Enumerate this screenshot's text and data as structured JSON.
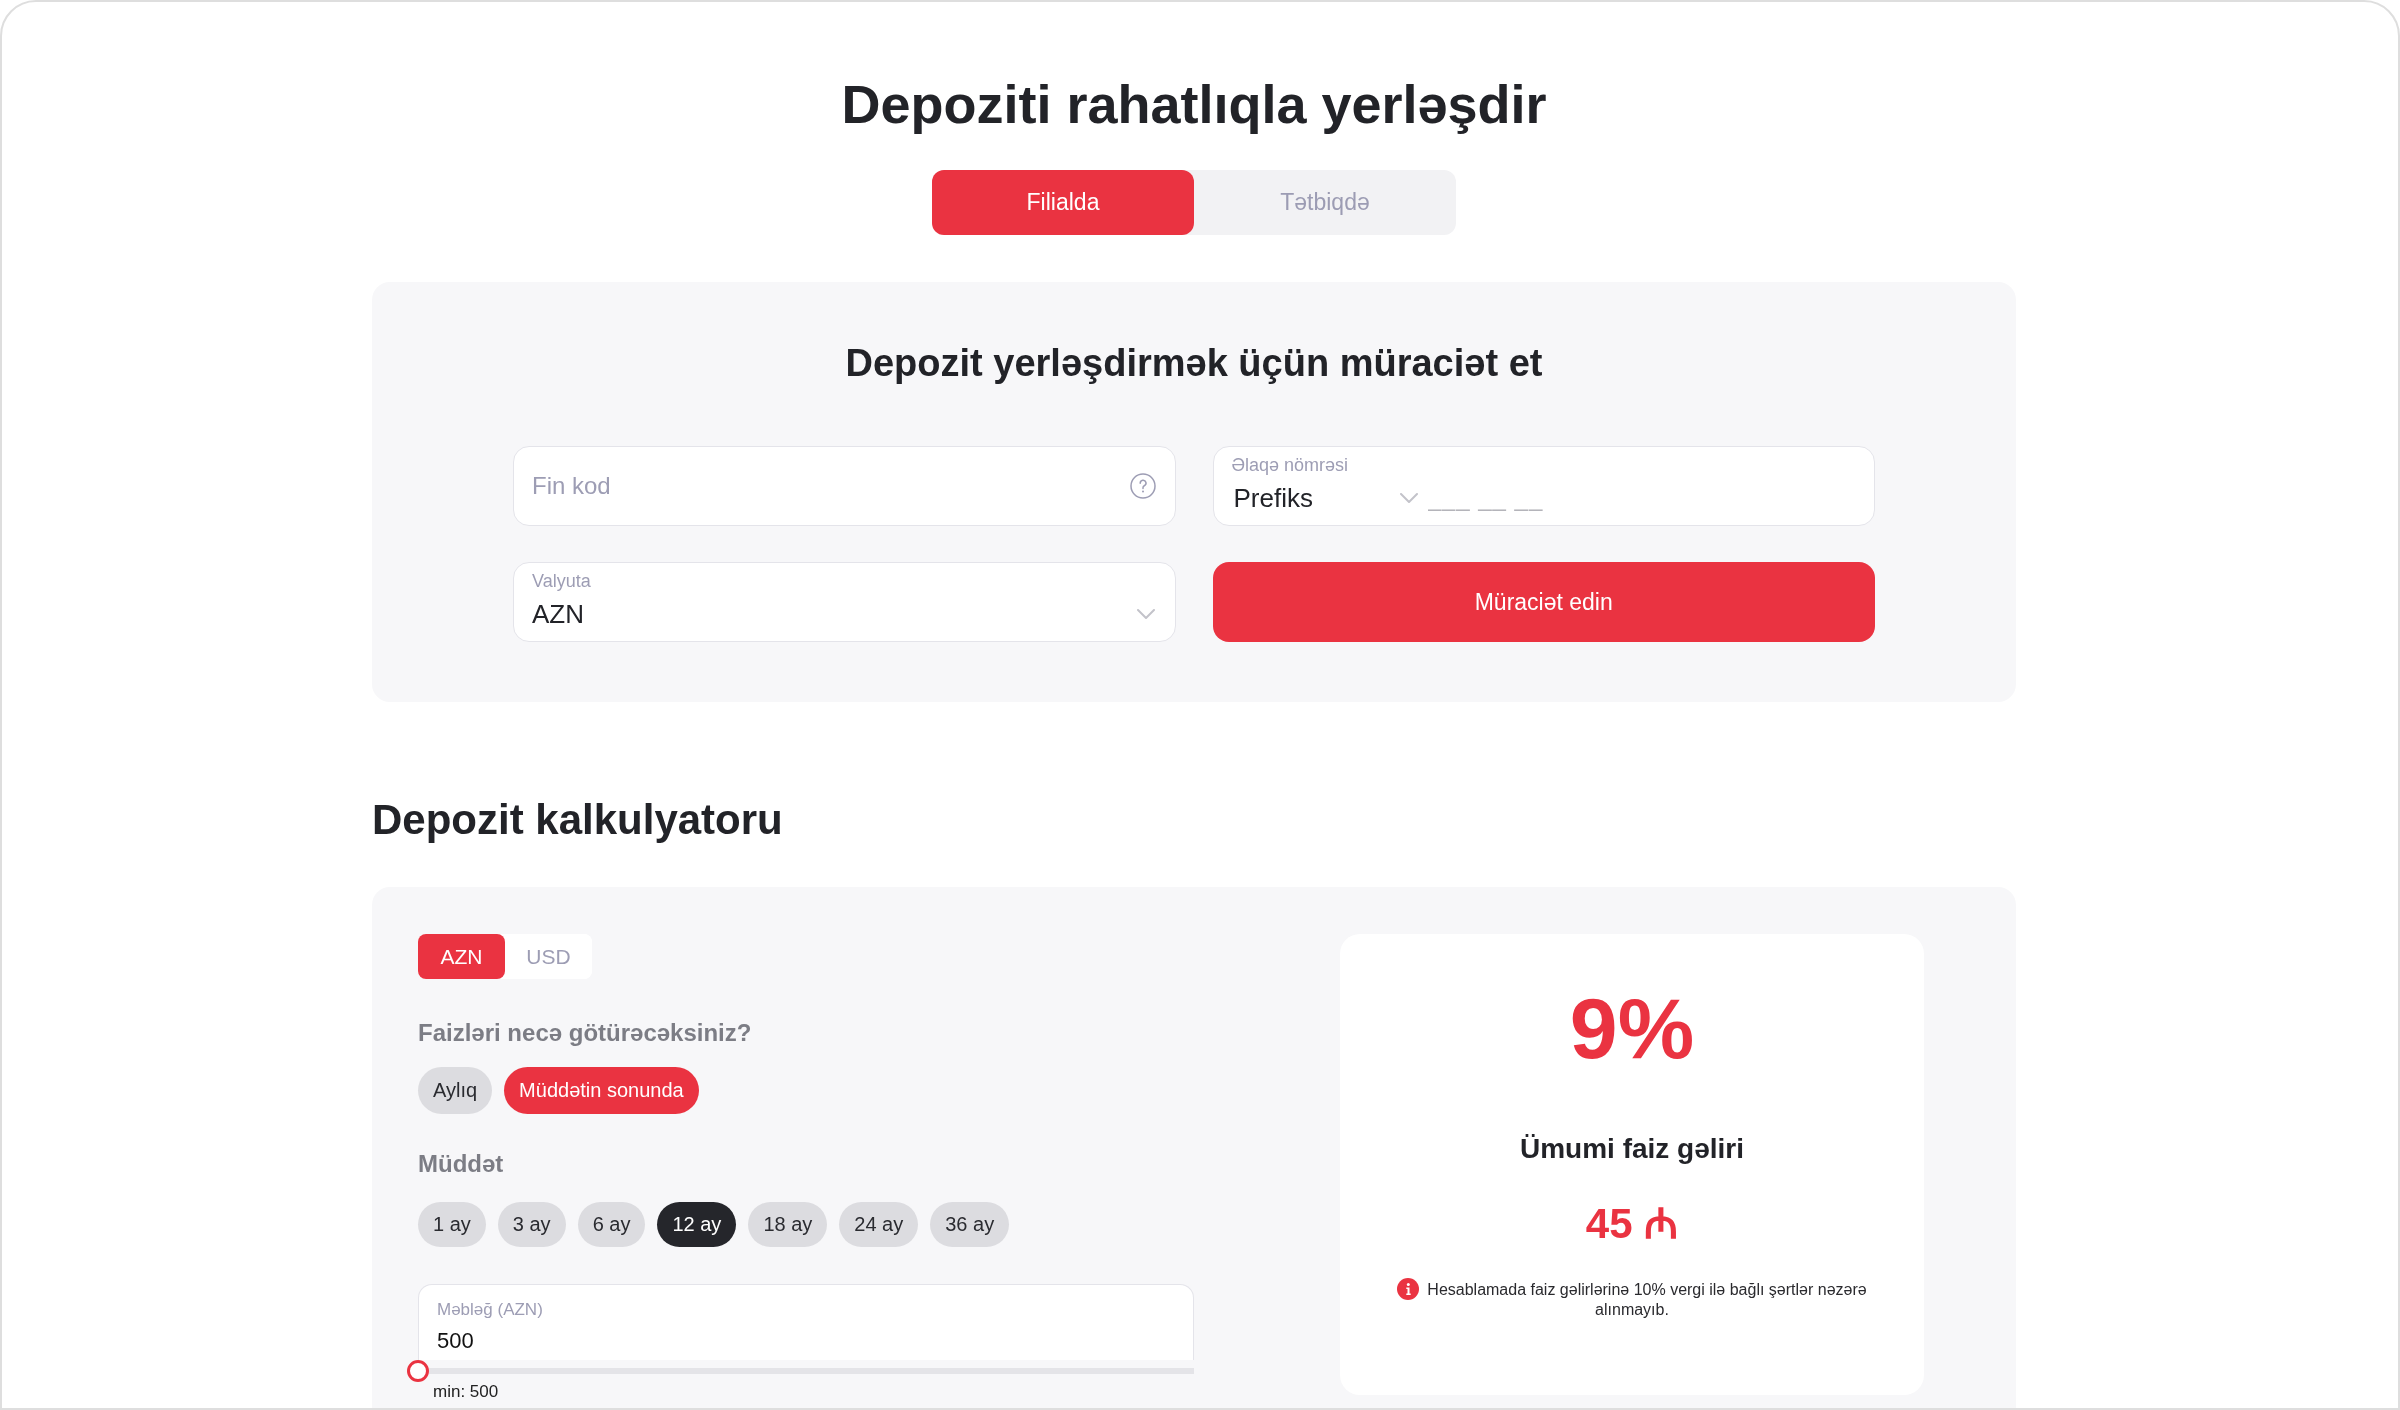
{
  "page_title": "Depoziti rahatlıqla yerləşdir",
  "channel_tabs": [
    {
      "label": "Filialda",
      "selected": true
    },
    {
      "label": "Tətbiqdə",
      "selected": false
    }
  ],
  "application": {
    "title": "Depozit yerləşdirmək üçün müraciət et",
    "fields": [
      {
        "kind": "text",
        "placeholder": "Fin kod"
      },
      {
        "kind": "phone",
        "label": "Əlaqə nömrəsi",
        "prefix": "Prefiks",
        "placeholder": "___ __ __"
      },
      {
        "kind": "select",
        "label": "Valyuta",
        "value": "AZN"
      }
    ],
    "submit_button": "Müraciət edin"
  },
  "calculator": {
    "title": "Depozit kalkulyatoru",
    "currency_tabs": [
      {
        "label": "AZN",
        "selected": true
      },
      {
        "label": "USD",
        "selected": false
      }
    ],
    "payout_question": "Faizləri necə götürəcəksiniz?",
    "payout_options": [
      {
        "label": "Aylıq",
        "selected": false
      },
      {
        "label": "Müddətin sonunda",
        "selected": true
      }
    ],
    "term_label": "Müddət",
    "terms": [
      {
        "label": "1 ay",
        "selected": false
      },
      {
        "label": "3 ay",
        "selected": false
      },
      {
        "label": "6 ay",
        "selected": false
      },
      {
        "label": "12 ay",
        "selected": true
      },
      {
        "label": "18 ay",
        "selected": false
      },
      {
        "label": "24 ay",
        "selected": false
      },
      {
        "label": "36 ay",
        "selected": false
      }
    ],
    "amount": {
      "label": "Məbləğ (AZN)",
      "value": "500",
      "level": 0,
      "min_label": "min: 500"
    },
    "result": {
      "rate": "9%",
      "income_label": "Ümumi faiz gəliri",
      "income": "45 ₼",
      "note": "Hesablamada faiz gəlirlərinə 10% vergi ilə bağlı şərtlər nəzərə alınmayıb."
    }
  }
}
